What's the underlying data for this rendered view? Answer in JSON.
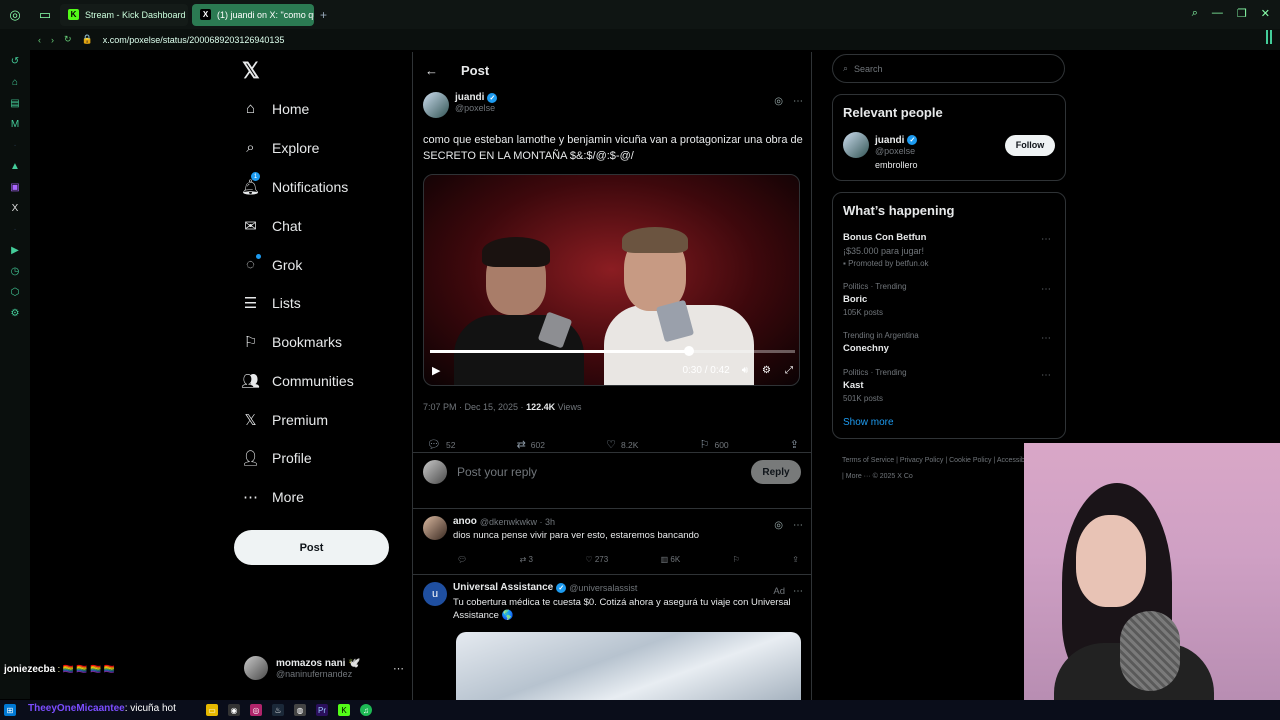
{
  "browser": {
    "tabs": [
      {
        "label": "Stream - Kick Dashboard",
        "active": false
      },
      {
        "label": "(1) juandi on X: \"como qu",
        "active": true
      }
    ],
    "url": "x.com/poxelse/status/2000689203126940135"
  },
  "nav": {
    "items": [
      {
        "label": "Home",
        "icon": "home-icon"
      },
      {
        "label": "Explore",
        "icon": "search-icon"
      },
      {
        "label": "Notifications",
        "icon": "bell-icon",
        "badge": "1"
      },
      {
        "label": "Chat",
        "icon": "mail-icon"
      },
      {
        "label": "Grok",
        "icon": "grok-icon"
      },
      {
        "label": "Lists",
        "icon": "list-icon"
      },
      {
        "label": "Bookmarks",
        "icon": "bookmark-icon"
      },
      {
        "label": "Communities",
        "icon": "communities-icon"
      },
      {
        "label": "Premium",
        "icon": "x-icon"
      },
      {
        "label": "Profile",
        "icon": "profile-icon"
      },
      {
        "label": "More",
        "icon": "more-icon"
      }
    ],
    "post_button": "Post",
    "account": {
      "name": "momazos nani 🕊️",
      "handle": "@naninufernandez"
    }
  },
  "main": {
    "header_title": "Post",
    "tweet": {
      "name": "juandi",
      "handle": "@poxelse",
      "text": "como que esteban lamothe y benjamin vicuña van a protagonizar una obra de SECRETO EN LA MONTAÑA $&:$/@:$-@/",
      "video": {
        "time": "0:30 / 0:42",
        "progress": 0.71
      },
      "timestamp": "7:07 PM · Dec 15, 2025 · ",
      "views_count": "122.4K",
      "views_label": " Views",
      "stats": {
        "replies": "52",
        "reposts": "602",
        "likes": "8.2K",
        "bookmarks": "600"
      }
    },
    "reply_box": {
      "placeholder": "Post your reply",
      "button": "Reply"
    },
    "reply": {
      "name": "anoo",
      "handle": "@dkenwkwkw · 3h",
      "text": "dios nunca pense vivir para ver esto, estaremos bancando",
      "stats": {
        "reposts": "3",
        "likes": "273",
        "views": "6K"
      }
    },
    "ad": {
      "name": "Universal Assistance",
      "handle": "@universalassist",
      "label": "Ad",
      "text": "Tu cobertura médica te cuesta $0. Cotizá ahora y asegurá tu viaje con Universal Assistance 🌎"
    }
  },
  "sidebar": {
    "search_placeholder": "Search",
    "relevant": {
      "title": "Relevant people",
      "name": "juandi",
      "handle": "@poxelse",
      "bio": "embrollero",
      "follow": "Follow"
    },
    "happening": {
      "title": "What’s happening",
      "trends": [
        {
          "meta": "",
          "name": "Bonus Con Betfun",
          "sub": "¡$35.000 para jugar!",
          "promo": "Promoted by betfun.ok"
        },
        {
          "meta": "Politics · Trending",
          "name": "Boric",
          "sub": "105K posts"
        },
        {
          "meta": "Trending in Argentina",
          "name": "Conechny",
          "sub": ""
        },
        {
          "meta": "Politics · Trending",
          "name": "Kast",
          "sub": "501K posts"
        }
      ],
      "show_more": "Show more"
    },
    "footer": "Terms of Service | Privacy Policy | Cookie Policy | Accessibility | Ads info | More ··· © 2025 X Co"
  },
  "stream_chat": {
    "user1": "joniezecba",
    "emotes1": ": 🏳️‍🌈 🏳️‍🌈 🏳️‍🌈 🏳️‍🌈",
    "user2": "TheeyOneMicaantee",
    "msg2": ": vicuña hot"
  },
  "colors": {
    "accent": "#1d9bf0",
    "tab_active": "#2b7a52",
    "rail": "#4c9"
  }
}
